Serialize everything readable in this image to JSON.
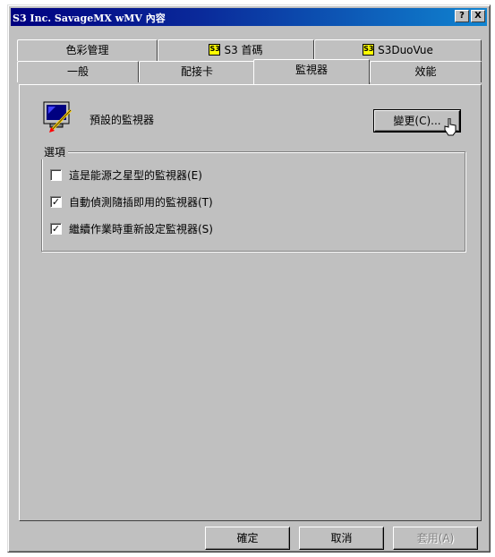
{
  "window": {
    "title": "S3 Inc. SavageMX wMV 內容",
    "help_label": "?",
    "close_label": "X"
  },
  "tabs_top": [
    {
      "label": "色彩管理"
    },
    {
      "label": "S3 首碼",
      "icon": "s3-chip-icon"
    },
    {
      "label": "S3DuoVue",
      "icon": "s3-chip-icon"
    }
  ],
  "tabs_bottom": [
    {
      "label": "一般"
    },
    {
      "label": "配接卡"
    },
    {
      "label": "監視器",
      "active": true
    },
    {
      "label": "效能"
    }
  ],
  "monitor": {
    "label": "預設的監視器",
    "change_button": "變更(C)..."
  },
  "options": {
    "legend": "選項",
    "items": [
      {
        "label": "這是能源之星型的監視器(E)",
        "checked": false
      },
      {
        "label": "自動偵測隨插即用的監視器(T)",
        "checked": true
      },
      {
        "label": "繼續作業時重新設定監視器(S)",
        "checked": true
      }
    ]
  },
  "footer": {
    "ok": "確定",
    "cancel": "取消",
    "apply": "套用(A)"
  },
  "colors": {
    "face": "#c0c0c0",
    "title_start": "#000080",
    "title_end": "#1084d0",
    "chip": "#ffff00"
  }
}
